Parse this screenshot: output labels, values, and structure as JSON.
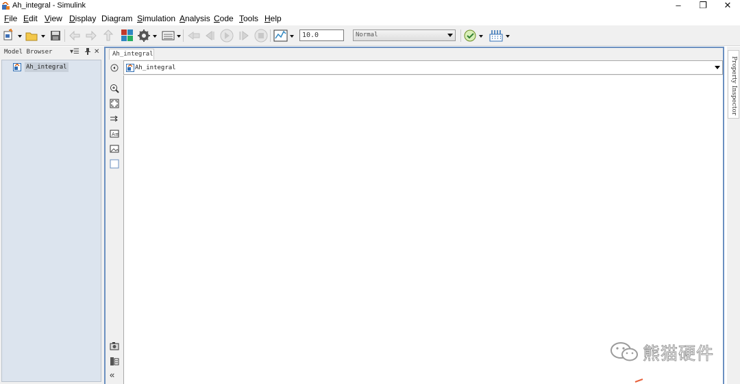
{
  "window": {
    "title": "Ah_integral - Simulink",
    "controls": {
      "minimize": "–",
      "maximize": "❐",
      "close": "✕"
    }
  },
  "menu": {
    "items": [
      {
        "first": "F",
        "rest": "ile",
        "underline": true
      },
      {
        "first": "E",
        "rest": "dit",
        "underline": true
      },
      {
        "first": "V",
        "rest": "iew",
        "underline": true
      },
      {
        "first": "D",
        "rest": "isplay",
        "underline": true
      },
      {
        "first": "",
        "rest": "Diagram",
        "underline": false
      },
      {
        "first": "S",
        "rest": "imulation",
        "underline": true
      },
      {
        "first": "A",
        "rest": "nalysis",
        "underline": true
      },
      {
        "first": "C",
        "rest": "ode",
        "underline": true
      },
      {
        "first": "T",
        "rest": "ools",
        "underline": true
      },
      {
        "first": "H",
        "rest": "elp",
        "underline": true
      }
    ]
  },
  "toolbar": {
    "stop_time": "10.0",
    "sim_mode": "Normal",
    "icons": [
      "new-model-icon",
      "open-folder-icon",
      "save-icon",
      "back-icon",
      "forward-icon",
      "up-icon",
      "library-browser-icon",
      "model-config-icon",
      "model-explorer-icon",
      "step-back-icon",
      "run-icon",
      "step-forward-icon",
      "stop-icon",
      "scope-icon",
      "model-advisor-icon",
      "build-icon"
    ]
  },
  "model_browser": {
    "title": "Model Browser",
    "controls": {
      "menu": "▾☰",
      "pin": "🖈",
      "close": "✕"
    },
    "root_node": "Ah_integral"
  },
  "editor": {
    "tab_label": "Ah_integral",
    "breadcrumb": "Ah_integral",
    "palette_icons": [
      "zoom-icon",
      "fit-to-view-icon",
      "arrow-icon",
      "annotation-icon",
      "image-icon",
      "area-icon",
      "screenshot-icon",
      "model-data-icon",
      "collapse-icon"
    ],
    "collapse_glyph": "«"
  },
  "property_inspector": {
    "label": "Property Inspector"
  },
  "watermark": {
    "text": "熊猫硬件"
  },
  "colors": {
    "accent": "#6a8fc0",
    "tree_bg": "#dce4ee",
    "toolbar_bg": "#f0f0f0"
  }
}
